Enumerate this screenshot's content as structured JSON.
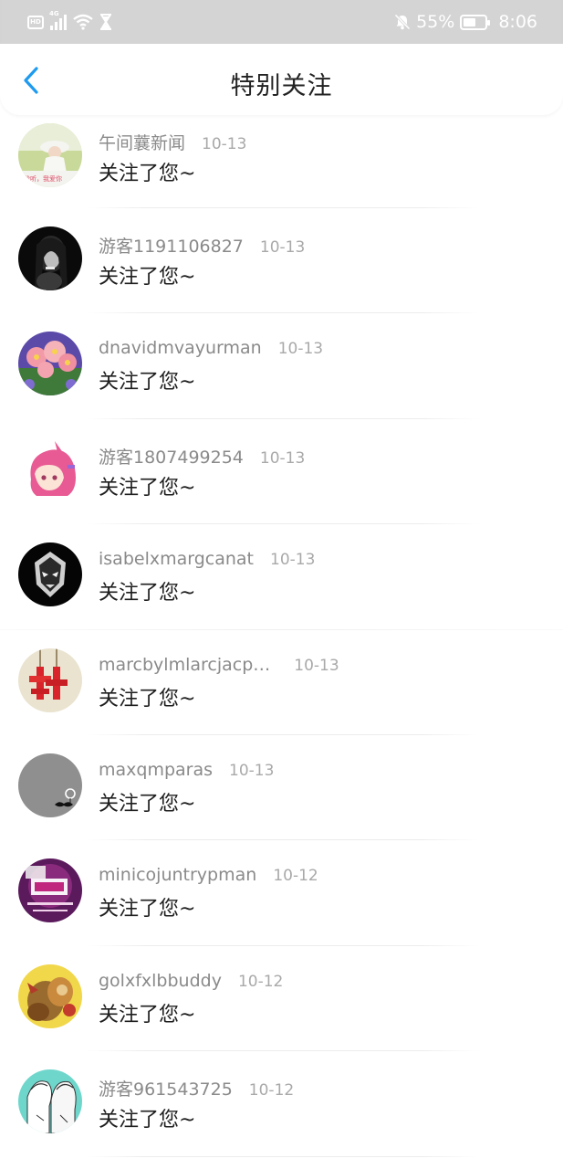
{
  "status_bar": {
    "hd": "HD",
    "network": "4G",
    "battery_percent": "55%",
    "time": "8:06",
    "icons": [
      "hd-icon",
      "signal-icon",
      "wifi-icon",
      "hourglass-icon",
      "mute-bell-icon",
      "battery-icon"
    ]
  },
  "header": {
    "title": "特别关注",
    "back_icon": "chevron-left-icon",
    "accent_color": "#1e9bf0"
  },
  "list": [
    {
      "name": "午间蘘新闻",
      "date": "10-13",
      "message": "关注了您~"
    },
    {
      "name": "游客1191106827",
      "date": "10-13",
      "message": "关注了您~"
    },
    {
      "name": "dnavidmvayurman",
      "date": "10-13",
      "message": "关注了您~"
    },
    {
      "name": "游客1807499254",
      "date": "10-13",
      "message": "关注了您~"
    },
    {
      "name": "isabelxmargcanat",
      "date": "10-13",
      "message": "关注了您~"
    },
    {
      "name": "marcbylmlarcjacp…",
      "date": "10-13",
      "message": "关注了您~"
    },
    {
      "name": "maxqmparas",
      "date": "10-13",
      "message": "关注了您~"
    },
    {
      "name": "minicojuntrypman",
      "date": "10-12",
      "message": "关注了您~"
    },
    {
      "name": "golxfxlbbuddy",
      "date": "10-12",
      "message": "关注了您~"
    },
    {
      "name": "游客961543725",
      "date": "10-12",
      "message": "关注了您~"
    }
  ],
  "avatar_texts": {
    "first_caption": "聆听，我爱你"
  }
}
